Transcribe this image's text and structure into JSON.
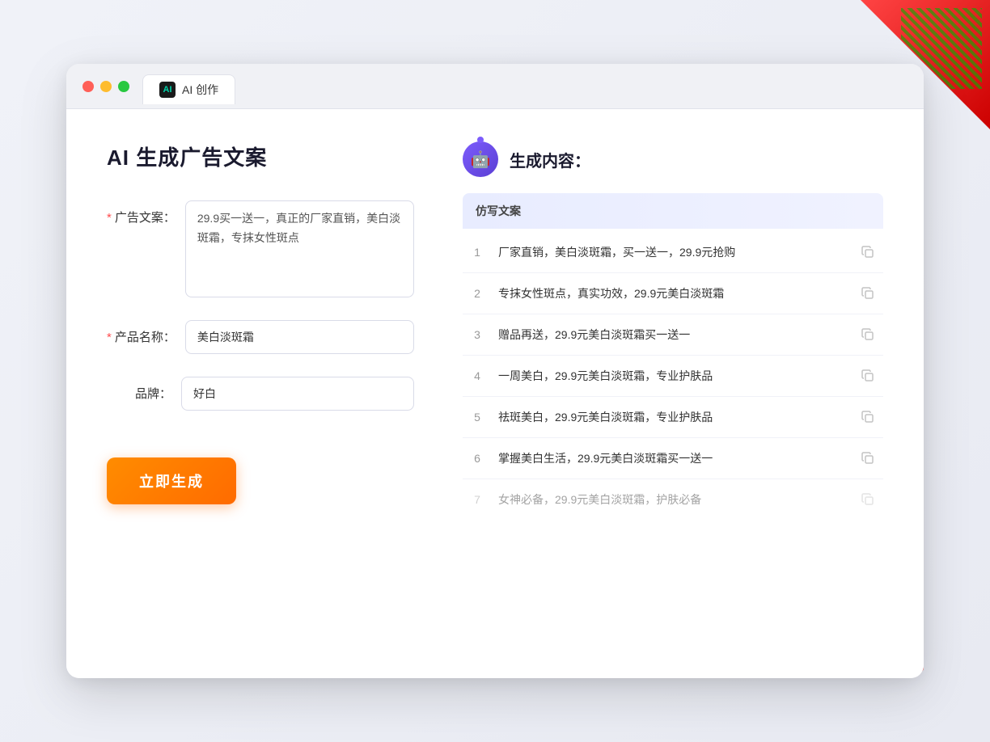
{
  "window": {
    "tab_label": "AI 创作",
    "tab_icon": "AI"
  },
  "traffic_lights": {
    "red": "red",
    "yellow": "yellow",
    "green": "green"
  },
  "left_panel": {
    "title": "AI  生成广告文案",
    "form": {
      "ad_copy_label": "广告文案：",
      "ad_copy_required": "*",
      "ad_copy_value": "29.9买一送一，真正的厂家直销，美白淡斑霜，专抹女性斑点",
      "product_name_label": "产品名称：",
      "product_name_required": "*",
      "product_name_value": "美白淡斑霜",
      "brand_label": "品牌：",
      "brand_value": "好白"
    },
    "generate_button": "立即生成"
  },
  "right_panel": {
    "title": "生成内容：",
    "table_header": "仿写文案",
    "results": [
      {
        "num": "1",
        "text": "厂家直销，美白淡斑霜，买一送一，29.9元抢购",
        "dimmed": false
      },
      {
        "num": "2",
        "text": "专抹女性斑点，真实功效，29.9元美白淡斑霜",
        "dimmed": false
      },
      {
        "num": "3",
        "text": "赠品再送，29.9元美白淡斑霜买一送一",
        "dimmed": false
      },
      {
        "num": "4",
        "text": "一周美白，29.9元美白淡斑霜，专业护肤品",
        "dimmed": false
      },
      {
        "num": "5",
        "text": "祛斑美白，29.9元美白淡斑霜，专业护肤品",
        "dimmed": false
      },
      {
        "num": "6",
        "text": "掌握美白生活，29.9元美白淡斑霜买一送一",
        "dimmed": false
      },
      {
        "num": "7",
        "text": "女神必备，29.9元美白淡斑霜，护肤必备",
        "dimmed": true
      }
    ]
  }
}
